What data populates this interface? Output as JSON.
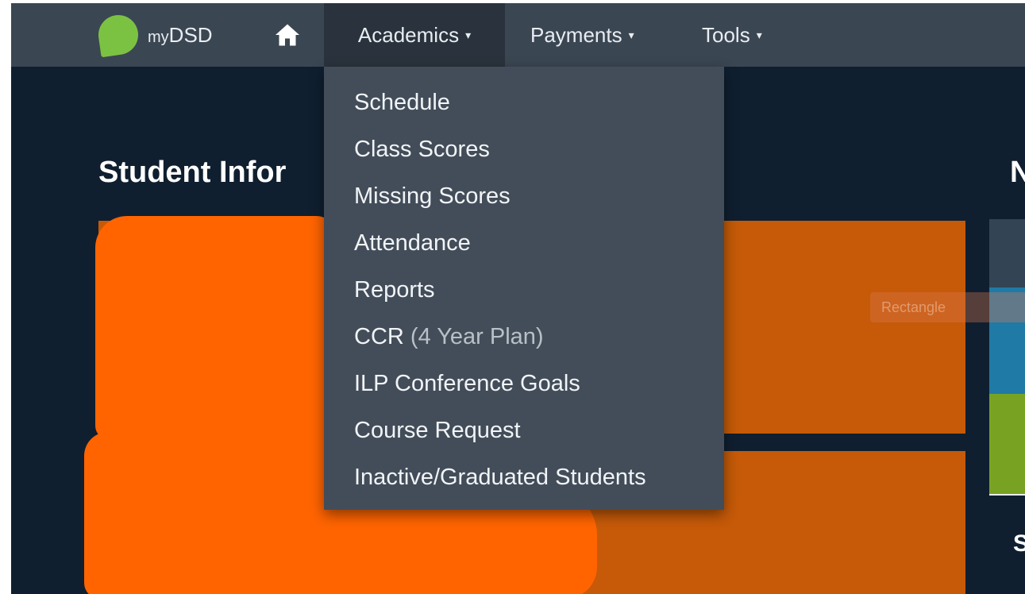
{
  "brand": {
    "name_small": "my",
    "name_main": "DSD"
  },
  "nav": {
    "home_icon": "home-icon",
    "items": [
      {
        "label": "Academics",
        "caret": "▾"
      },
      {
        "label": "Payments",
        "caret": "▾"
      },
      {
        "label": "Tools",
        "caret": "▾"
      }
    ]
  },
  "main": {
    "section_title": "Student Infor",
    "right_title_fragment": "N",
    "right_title_fragment_2": "S",
    "ghost_button_label": "Rectangle"
  },
  "dropdown": {
    "items": [
      {
        "label": "Schedule"
      },
      {
        "label": "Class Scores"
      },
      {
        "label": "Missing Scores"
      },
      {
        "label": "Attendance"
      },
      {
        "label": "Reports"
      },
      {
        "label": "CCR",
        "suffix": "(4 Year Plan)"
      },
      {
        "label": "ILP Conference Goals"
      },
      {
        "label": "Course Request"
      },
      {
        "label": "Inactive/Graduated Students"
      }
    ]
  },
  "colors": {
    "navbar": "#3b4653",
    "dropdown": "#434d59",
    "page_bg": "#0f1f30",
    "brand_leaf": "#7cc242",
    "card": "#c65a08",
    "redaction": "#ff6400"
  }
}
